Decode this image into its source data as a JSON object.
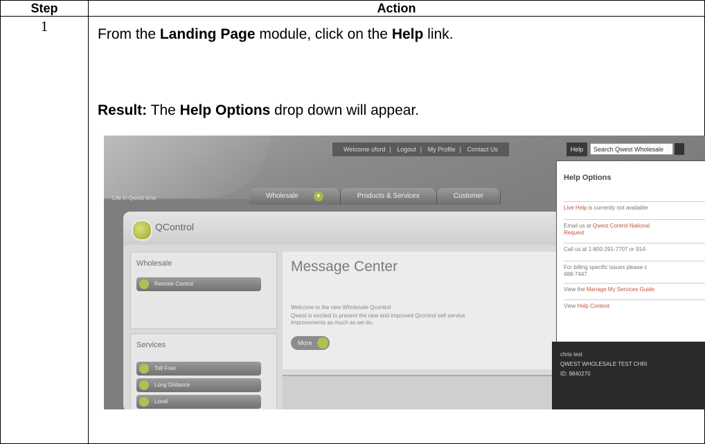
{
  "table": {
    "header_step": "Step",
    "header_action": "Action",
    "step_number": "1",
    "instruction": {
      "prefix": "From the ",
      "module_name": "Landing Page",
      "middle": " module, click on the ",
      "link_name": "Help",
      "suffix": " link."
    },
    "result": {
      "label": "Result:",
      "text_before": " The ",
      "dropdown_name": "Help Options",
      "text_after": " drop down will appear."
    }
  },
  "screenshot": {
    "top_links": [
      "Welcome uford",
      "Logout",
      "My Profile",
      "Contact Us"
    ],
    "help_link": "Help",
    "search_placeholder": "Search Qwest Wholesale",
    "tagline": "Life in Qwest time",
    "tabs": [
      "Wholesale",
      "Products & Services",
      "Customer"
    ],
    "app_title": "QControl",
    "sidebar": {
      "wholesale_heading": "Wholesale",
      "wholesale_item": "Remote Control",
      "services_heading": "Services",
      "services_items": [
        "Toll Free",
        "Long Distance",
        "Local"
      ]
    },
    "message_center": {
      "title": "Message Center",
      "welcome": "Welcome to the new Wholesale Qcontrol",
      "body1": "Qwest is excited to present the new and improved Qcontrol self service",
      "body2": "improvements as much as we do.",
      "more_button": "More"
    },
    "help_dropdown": {
      "title": "Help Options",
      "live_help_link": "Live Help",
      "live_help_text": " is currently not available",
      "email_prefix": "Email us at ",
      "email_link": "Qwest Control National",
      "email_suffix": "Request",
      "call": "Call us at 1-800-291-7707 or 914-",
      "billing": "For billing specific issues please c",
      "billing_number": "488-7447",
      "view_prefix": "View the ",
      "view_link": "Manage My Services Guide",
      "view_help_prefix": "View ",
      "view_help_link": "Help Content",
      "footer_name": "chris test",
      "footer_company": "QWEST WHOLESALE TEST CHRI",
      "footer_id": "ID: 9840270"
    }
  }
}
